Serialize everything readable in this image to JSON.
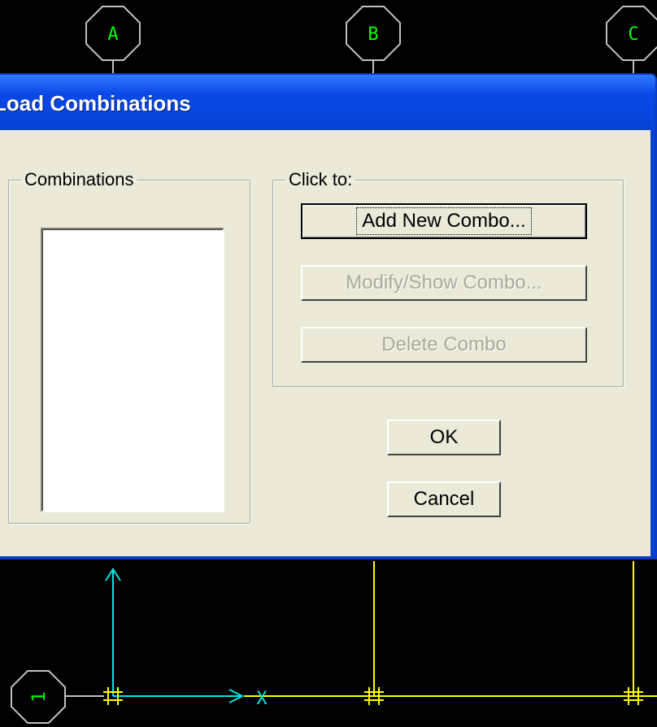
{
  "cad_view": {
    "grid_bubbles_top": [
      "A",
      "B",
      "C"
    ],
    "grid_bubble_left": "1",
    "axis_x_label": "X",
    "colors": {
      "bubble": "#00ff00",
      "grid_line": "#ffff00",
      "axis": "#00e6e6",
      "outline": "#c0c0c0"
    }
  },
  "dialog": {
    "title": "Load Combinations",
    "combinations_group_label": "Combinations",
    "combinations_items": [],
    "click_group_label": "Click to:",
    "add_button": "Add New Combo...",
    "modify_button": "Modify/Show Combo...",
    "delete_button": "Delete Combo",
    "ok_button": "OK",
    "cancel_button": "Cancel"
  }
}
